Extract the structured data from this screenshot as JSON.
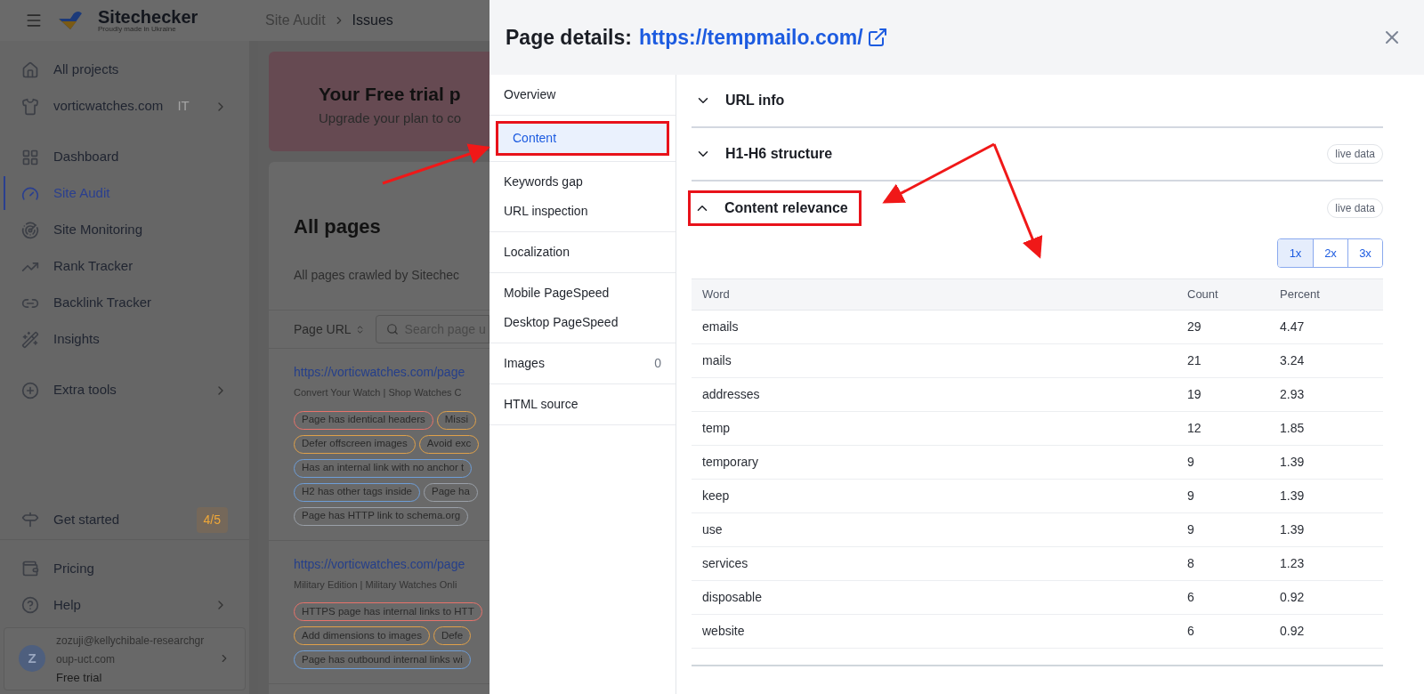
{
  "app": {
    "logo": {
      "name": "Sitechecker",
      "tagline": "Proudly made in Ukraine"
    },
    "breadcrumb": [
      "Site Audit",
      "Issues"
    ],
    "sidebar": {
      "items": [
        {
          "label": "All projects",
          "kind": "home",
          "selected": false
        },
        {
          "label": "vorticwatches.com",
          "kind": "project",
          "suffix": "IT",
          "selected": false
        },
        {
          "label": "Dashboard",
          "kind": "dashboard",
          "selected": false
        },
        {
          "label": "Site Audit",
          "kind": "audit",
          "selected": true
        },
        {
          "label": "Site Monitoring",
          "kind": "monitor",
          "selected": false
        },
        {
          "label": "Rank Tracker",
          "kind": "rank",
          "selected": false
        },
        {
          "label": "Backlink Tracker",
          "kind": "link",
          "selected": false
        },
        {
          "label": "Insights",
          "kind": "insights",
          "selected": false
        },
        {
          "label": "Extra tools",
          "kind": "extra",
          "selected": false
        }
      ],
      "get_started": {
        "label": "Get started",
        "badge": "4/5"
      },
      "bottom_items": [
        {
          "label": "Pricing",
          "kind": "pricing"
        },
        {
          "label": "Help",
          "kind": "help"
        }
      ],
      "user": {
        "avatar": "Z",
        "email": "zozuji@kellychibale-researchgroup-uct.com",
        "plan": "Free trial"
      }
    },
    "banner": {
      "title": "Your Free trial p",
      "subtitle": "Upgrade your plan to co"
    },
    "pages_card": {
      "title": "All pages",
      "subtitle": "All pages crawled by Sitechec",
      "sort_label": "Page URL",
      "search": {
        "placeholder": "Search page u"
      },
      "pages": [
        {
          "url": "https://vorticwatches.com/page",
          "title": "Convert Your Watch | Shop Watches C",
          "tag_rows": [
            [
              {
                "label": "Page has identical headers",
                "color": "#e8736b"
              },
              {
                "label": "Missi",
                "color": "#e0a14a"
              }
            ],
            [
              {
                "label": "Defer offscreen images",
                "color": "#e0a14a"
              },
              {
                "label": "Avoid exc",
                "color": "#e0a14a"
              }
            ],
            [
              {
                "label": "Has an internal link with no anchor t",
                "color": "#6e9ed8"
              }
            ],
            [
              {
                "label": "H2 has other tags inside",
                "color": "#6e9ed8"
              },
              {
                "label": "Page ha",
                "color": "#9aa0a8"
              }
            ],
            [
              {
                "label": "Page has HTTP link to schema.org",
                "color": "#9aa0a8"
              }
            ]
          ]
        },
        {
          "url": "https://vorticwatches.com/page",
          "title": "Military Edition | Military Watches Onli",
          "tag_rows": [
            [
              {
                "label": "HTTPS page has internal links to HTT",
                "color": "#e8736b"
              }
            ],
            [
              {
                "label": "Add dimensions to images",
                "color": "#e0a14a"
              },
              {
                "label": "Defe",
                "color": "#e0a14a"
              }
            ],
            [
              {
                "label": "Page has outbound internal links wi",
                "color": "#6e9ed8"
              }
            ]
          ]
        }
      ]
    }
  },
  "modal": {
    "title": "Page details:",
    "url": "https://tempmailo.com/",
    "nav_groups": [
      [
        {
          "label": "Overview",
          "selected": false
        }
      ],
      [
        {
          "label": "Content",
          "selected": true,
          "highlighted": true
        }
      ],
      [
        {
          "label": "Keywords gap",
          "selected": false
        },
        {
          "label": "URL inspection",
          "selected": false
        }
      ],
      [
        {
          "label": "Localization",
          "selected": false
        }
      ],
      [
        {
          "label": "Mobile PageSpeed",
          "selected": false
        },
        {
          "label": "Desktop PageSpeed",
          "selected": false
        }
      ],
      [
        {
          "label": "Images",
          "selected": false,
          "count": "0"
        }
      ],
      [
        {
          "label": "HTML source",
          "selected": false
        }
      ]
    ],
    "sections": [
      {
        "title": "URL info",
        "expanded": false
      },
      {
        "title": "H1-H6 structure",
        "expanded": false,
        "badge": "live data"
      },
      {
        "title": "Content relevance",
        "expanded": true,
        "badge": "live data",
        "highlighted": true
      }
    ],
    "multipliers": [
      {
        "label": "1x",
        "selected": true
      },
      {
        "label": "2x",
        "selected": false
      },
      {
        "label": "3x",
        "selected": false
      }
    ],
    "table": {
      "columns": [
        "Word",
        "Count",
        "Percent"
      ],
      "rows": [
        [
          "emails",
          "29",
          "4.47"
        ],
        [
          "mails",
          "21",
          "3.24"
        ],
        [
          "addresses",
          "19",
          "2.93"
        ],
        [
          "temp",
          "12",
          "1.85"
        ],
        [
          "temporary",
          "9",
          "1.39"
        ],
        [
          "keep",
          "9",
          "1.39"
        ],
        [
          "use",
          "9",
          "1.39"
        ],
        [
          "services",
          "8",
          "1.23"
        ],
        [
          "disposable",
          "6",
          "0.92"
        ],
        [
          "website",
          "6",
          "0.92"
        ]
      ]
    }
  }
}
